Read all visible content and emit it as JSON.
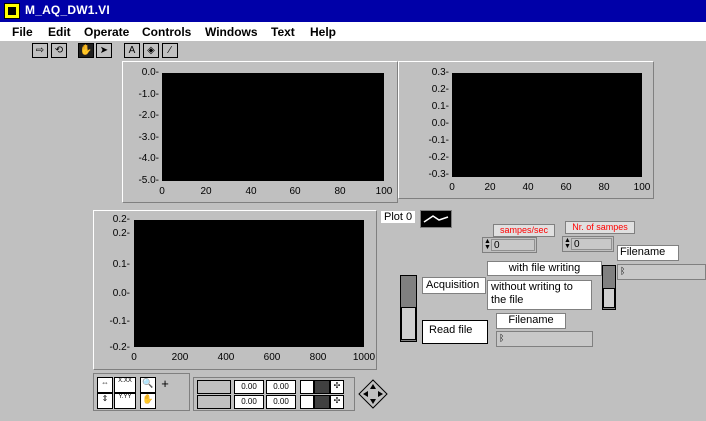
{
  "window": {
    "title": "M_AQ_DW1.VI"
  },
  "menu": {
    "file": "File",
    "edit": "Edit",
    "operate": "Operate",
    "controls": "Controls",
    "windows": "Windows",
    "text": "Text",
    "help": "Help"
  },
  "graph1": {
    "y_ticks": [
      "0.0-",
      "-1.0-",
      "-2.0-",
      "-3.0-",
      "-4.0-",
      "-5.0-"
    ],
    "x_ticks": [
      "0",
      "20",
      "40",
      "60",
      "80",
      "100"
    ]
  },
  "graph2": {
    "y_ticks": [
      "0.3-",
      "0.2-",
      "0.1-",
      "0.0-",
      "-0.1-",
      "-0.2-",
      "-0.3-"
    ],
    "x_ticks": [
      "0",
      "20",
      "40",
      "60",
      "80",
      "100"
    ]
  },
  "graph3": {
    "y_ticks": [
      "0.2-",
      "0.2-",
      "0.1-",
      "0.0-",
      "-0.1-",
      "-0.2-"
    ],
    "x_ticks": [
      "0",
      "200",
      "400",
      "600",
      "800",
      "1000"
    ]
  },
  "legend": {
    "plot0": "Plot 0"
  },
  "controls": {
    "sampes_sec_label": "sampes/sec",
    "sampes_sec_value": "0",
    "nr_samples_label": "Nr. of sampes",
    "nr_samples_value": "0",
    "filename1": "Filename",
    "filename2": "Filename",
    "with_file_writing": "with file writing",
    "without_writing": "without writing to the file",
    "acquisition": "Acquisition",
    "read_file": "Read file"
  },
  "cursor_palette": {
    "field1": "0.00",
    "field2": "0.00",
    "field3": "0.00",
    "field4": "0.00",
    "fmt1": "X.XX",
    "fmt2": "Y.YY"
  }
}
